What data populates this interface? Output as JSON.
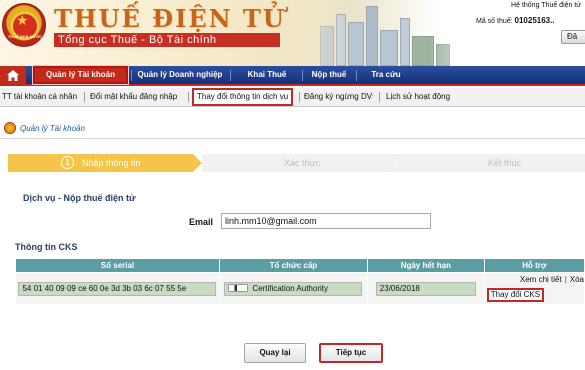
{
  "header": {
    "emblem_text": "THUẾ NHÀ NƯỚC",
    "title": "THUẾ ĐIỆN TỬ",
    "subtitle": "Tổng cục Thuế - Bộ Tài chính",
    "system_info": "Hệ thống Thuế điện tử",
    "mst_label": "Mã số thuế:",
    "mst_value": "01025163..",
    "logout_label": "Đă"
  },
  "mainnav": {
    "home_icon": "home-icon",
    "items": [
      {
        "label": "Quản lý Tài khoản"
      },
      {
        "label": "Quản lý Doanh nghiệp"
      },
      {
        "label": "Khai Thuế"
      },
      {
        "label": "Nộp thuế"
      },
      {
        "label": "Tra cứu"
      }
    ]
  },
  "subnav": {
    "items": [
      {
        "label": "TT tài khoản cá nhân"
      },
      {
        "label": "Đổi mật khẩu đăng nhập"
      },
      {
        "label": "Thay đổi thông tin dịch vụ"
      },
      {
        "label": "Đăng ký ngừng DV"
      },
      {
        "label": "Lịch sử hoạt động"
      }
    ]
  },
  "section": {
    "title": "Quản lý Tài khoản"
  },
  "steps": {
    "step1_num": "1",
    "step1_label": "Nhập thông tin",
    "step2_label": "Xác thực",
    "step3_label": "Kết thúc"
  },
  "service": {
    "title": "Dịch vụ - Nộp thuế điện tử",
    "email_label": "Email",
    "email_value": "linh.mm10@gmail.com"
  },
  "cks": {
    "title": "Thông tin CKS",
    "columns": [
      "Số serial",
      "Tổ chức cấp",
      "Ngày hết hạn",
      "Hỗ trợ"
    ],
    "row": {
      "serial": "54 01 40 09 09 ce 60 0e 3d 3b 03 6c 07 55 5e",
      "issuer": "Certification Authority",
      "expiry": "23/06/2018",
      "view_link": "Xem chi tiết",
      "delete_link": "Xóa",
      "change_link": "Thay đổi CKS"
    }
  },
  "buttons": {
    "back": "Quay lại",
    "next": "Tiếp tục"
  },
  "colors": {
    "nav_blue": "#1d3b8a",
    "active_red": "#c22a1c",
    "step_active": "#f5c44a",
    "table_header": "#5a9ea4"
  }
}
